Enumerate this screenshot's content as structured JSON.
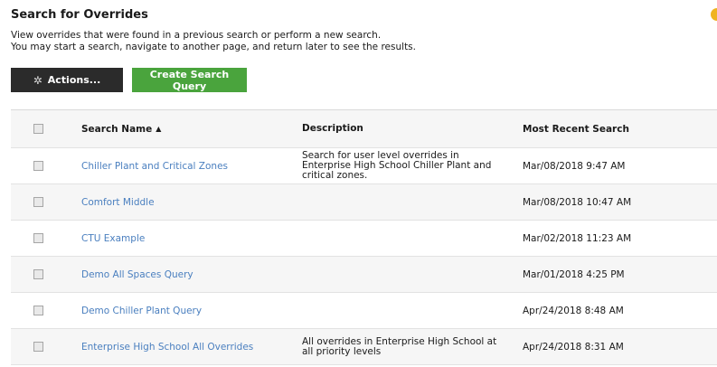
{
  "header": {
    "title": "Search for Overrides",
    "description_line1": "View overrides that were found in a previous search or perform a new search.",
    "description_line2": "You may start a search, navigate to another page, and return later to see the results."
  },
  "toolbar": {
    "actions_label": "Actions...",
    "actions_icon": "gear-icon",
    "create_label": "Create Search Query"
  },
  "table": {
    "columns": {
      "name": "Search Name",
      "description": "Description",
      "recent": "Most Recent Search"
    },
    "sort_indicator": "▲",
    "rows": [
      {
        "name": "Chiller Plant and Critical Zones",
        "description": "Search for user level overrides in Enterprise High School Chiller Plant and critical zones.",
        "recent": "Mar/08/2018 9:47 AM"
      },
      {
        "name": "Comfort Middle",
        "description": "",
        "recent": "Mar/08/2018 10:47 AM"
      },
      {
        "name": "CTU Example",
        "description": "",
        "recent": "Mar/02/2018 11:23 AM"
      },
      {
        "name": "Demo All Spaces Query",
        "description": "",
        "recent": "Mar/01/2018 4:25 PM"
      },
      {
        "name": "Demo Chiller Plant Query",
        "description": "",
        "recent": "Apr/24/2018 8:48 AM"
      },
      {
        "name": "Enterprise High School All Overrides",
        "description": "All overrides in Enterprise High School at all priority levels",
        "recent": "Apr/24/2018 8:31 AM"
      }
    ]
  },
  "colors": {
    "actions_button": "#2b2b2b",
    "create_button": "#4aa43d",
    "link": "#4a7fbf",
    "status_dot": "#f0b320"
  }
}
